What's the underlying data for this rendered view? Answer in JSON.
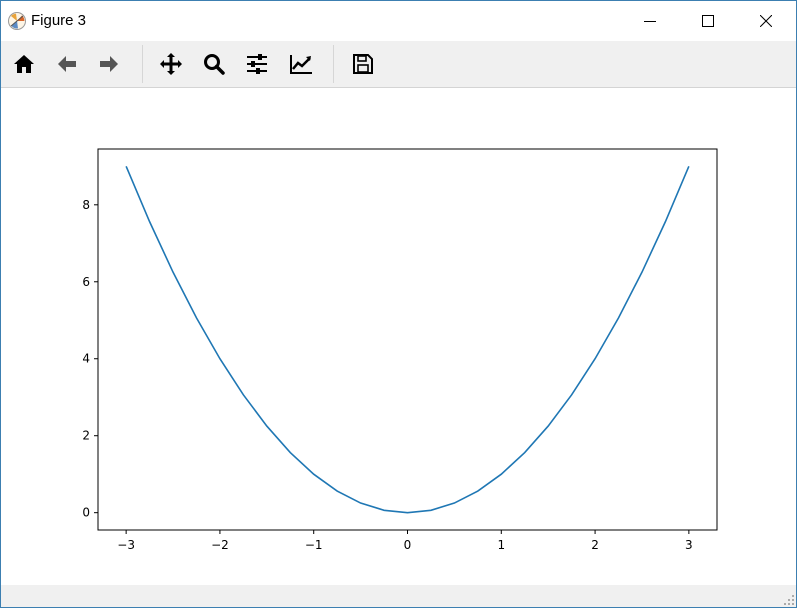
{
  "window": {
    "title": "Figure 3"
  },
  "toolbar": {
    "tools": [
      {
        "name": "home",
        "icon": "home-icon"
      },
      {
        "name": "back",
        "icon": "arrow-left-icon"
      },
      {
        "name": "forward",
        "icon": "arrow-right-icon"
      },
      {
        "name": "pan",
        "icon": "move-icon"
      },
      {
        "name": "zoom",
        "icon": "magnifier-icon"
      },
      {
        "name": "subplots",
        "icon": "sliders-icon"
      },
      {
        "name": "edit-axis",
        "icon": "line-chart-icon"
      },
      {
        "name": "save",
        "icon": "floppy-disk-icon"
      }
    ]
  },
  "colors": {
    "line": "#1f77b4",
    "axis": "#000000",
    "toolbar_bg": "#f0f0f0",
    "window_border": "#3c7fb1"
  },
  "chart_data": {
    "type": "line",
    "title": "",
    "xlabel": "",
    "ylabel": "",
    "xlim": [
      -3.3,
      3.3
    ],
    "ylim": [
      -0.45,
      9.45
    ],
    "xticks": [
      -3,
      -2,
      -1,
      0,
      1,
      2,
      3
    ],
    "xtick_labels": [
      "−3",
      "−2",
      "−1",
      "0",
      "1",
      "2",
      "3"
    ],
    "yticks": [
      0,
      2,
      4,
      6,
      8
    ],
    "ytick_labels": [
      "0",
      "2",
      "4",
      "6",
      "8"
    ],
    "grid": false,
    "legend": "none",
    "series": [
      {
        "x": [
          -3.0,
          -2.75,
          -2.5,
          -2.25,
          -2.0,
          -1.75,
          -1.5,
          -1.25,
          -1.0,
          -0.75,
          -0.5,
          -0.25,
          0.0,
          0.25,
          0.5,
          0.75,
          1.0,
          1.25,
          1.5,
          1.75,
          2.0,
          2.25,
          2.5,
          2.75,
          3.0
        ],
        "y": [
          9.0,
          7.5625,
          6.25,
          5.0625,
          4.0,
          3.0625,
          2.25,
          1.5625,
          1.0,
          0.5625,
          0.25,
          0.0625,
          0.0,
          0.0625,
          0.25,
          0.5625,
          1.0,
          1.5625,
          2.25,
          3.0625,
          4.0,
          5.0625,
          6.25,
          7.5625,
          9.0
        ]
      }
    ]
  }
}
